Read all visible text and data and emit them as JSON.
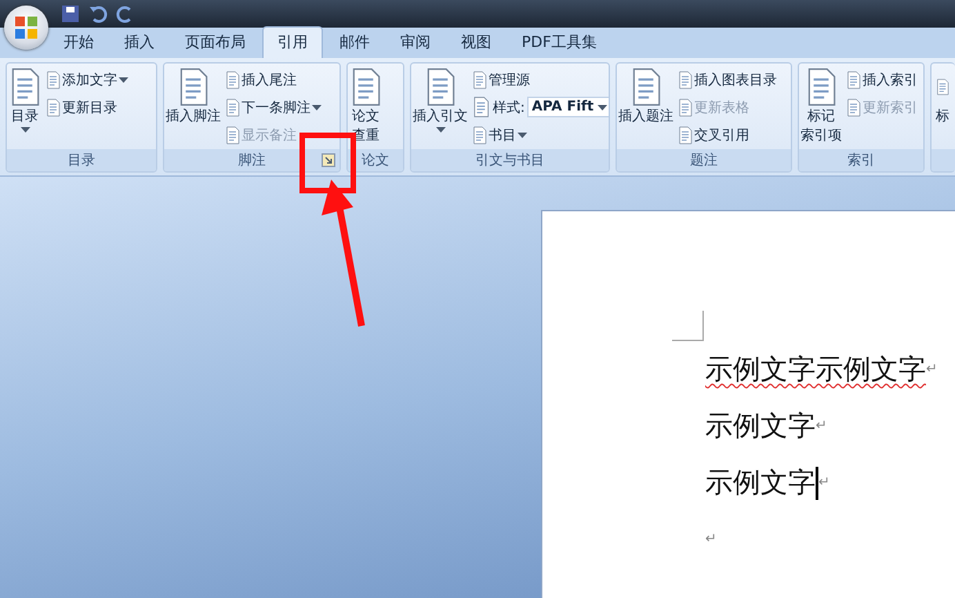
{
  "tabs": [
    {
      "label": "开始",
      "selected": false
    },
    {
      "label": "插入",
      "selected": false
    },
    {
      "label": "页面布局",
      "selected": false
    },
    {
      "label": "引用",
      "selected": true
    },
    {
      "label": "邮件",
      "selected": false
    },
    {
      "label": "审阅",
      "selected": false
    },
    {
      "label": "视图",
      "selected": false
    },
    {
      "label": "PDF工具集",
      "selected": false
    }
  ],
  "ribbon": {
    "groups": [
      {
        "label": "目录",
        "large": [
          {
            "lines": [
              "目录"
            ],
            "caret": true
          }
        ],
        "small": [
          {
            "kind": "button",
            "label": "添加文字",
            "caret": true
          },
          {
            "kind": "button",
            "label": "更新目录"
          }
        ]
      },
      {
        "label": "脚注",
        "launcher": true,
        "large": [
          {
            "lines": [
              "插入脚注"
            ]
          }
        ],
        "small": [
          {
            "kind": "button",
            "label": "插入尾注"
          },
          {
            "kind": "button",
            "label": "下一条脚注",
            "caret": true
          },
          {
            "kind": "button",
            "label": "显示备注",
            "disabled": true
          }
        ]
      },
      {
        "label": "论文",
        "large": [
          {
            "lines": [
              "论文",
              "查重"
            ]
          }
        ]
      },
      {
        "label": "引文与书目",
        "large": [
          {
            "lines": [
              "插入引文"
            ],
            "caret": true
          }
        ],
        "small": [
          {
            "kind": "button",
            "label": "管理源"
          },
          {
            "kind": "select",
            "label": "样式:",
            "value": "APA Fift",
            "caret": true
          },
          {
            "kind": "button",
            "label": "书目",
            "caret": true
          }
        ]
      },
      {
        "label": "题注",
        "large": [
          {
            "lines": [
              "插入题注"
            ]
          }
        ],
        "small": [
          {
            "kind": "button",
            "label": "插入图表目录"
          },
          {
            "kind": "button",
            "label": "更新表格",
            "disabled": true
          },
          {
            "kind": "button",
            "label": "交叉引用"
          }
        ]
      },
      {
        "label": "索引",
        "large": [
          {
            "lines": [
              "标记",
              "索引项"
            ]
          }
        ],
        "small": [
          {
            "kind": "button",
            "label": "插入索引"
          },
          {
            "kind": "button",
            "label": "更新索引",
            "disabled": true
          }
        ]
      },
      {
        "large": [
          {
            "lines": [
              "标"
            ]
          }
        ]
      }
    ]
  },
  "document": {
    "paragraphs": [
      {
        "text": "示例文字示例文字",
        "mark": "↵",
        "spelling_error": true
      },
      {
        "text": "示例文字",
        "mark": "↵"
      },
      {
        "text": "示例文字",
        "mark": "↵",
        "cursor": true
      },
      {
        "mark": "↵"
      }
    ]
  }
}
